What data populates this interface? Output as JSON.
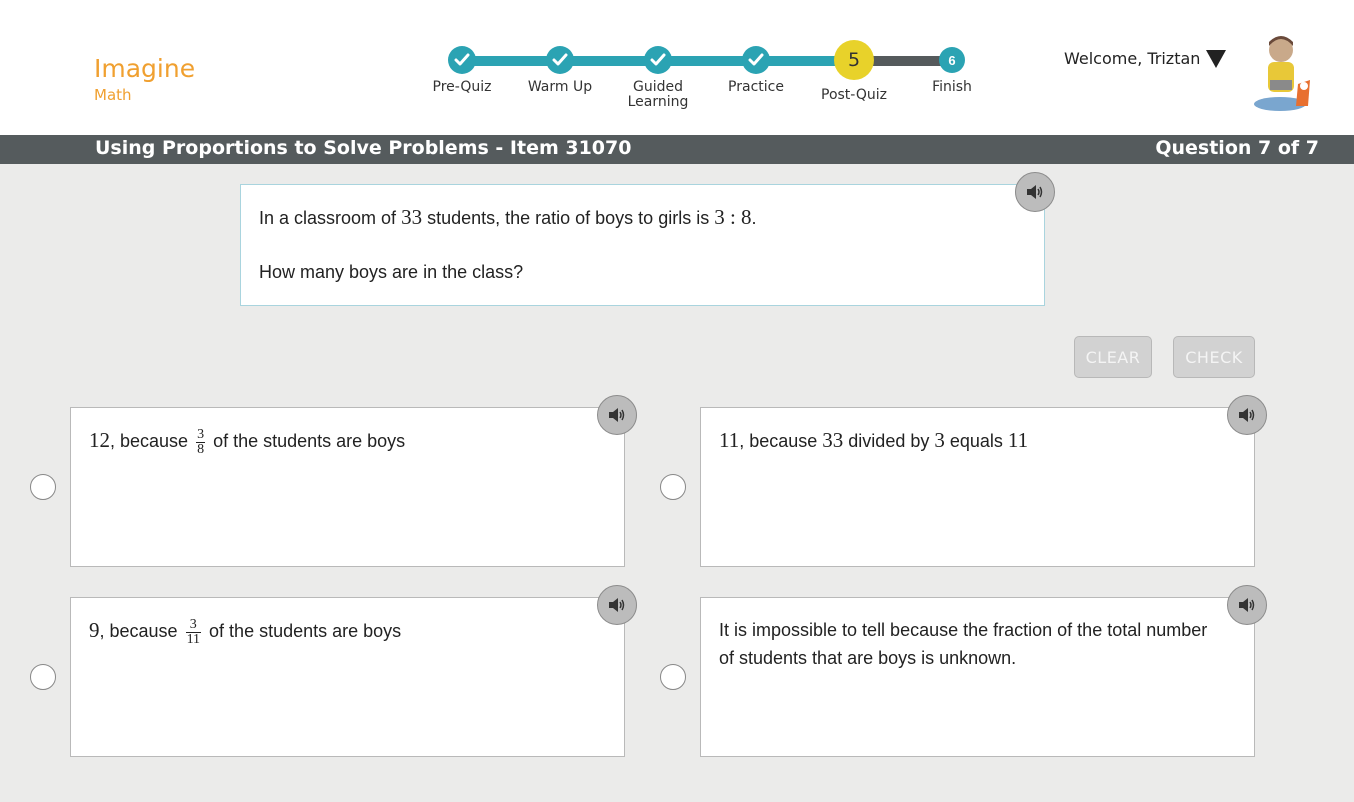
{
  "brand": {
    "name": "Imagine",
    "sub": "Math",
    "color": "#f0a030"
  },
  "progress": {
    "steps": [
      {
        "label": "Pre-Quiz",
        "state": "complete"
      },
      {
        "label": "Warm Up",
        "state": "complete"
      },
      {
        "label": "Guided Learning",
        "state": "complete"
      },
      {
        "label": "Practice",
        "state": "complete"
      },
      {
        "label": "Post-Quiz",
        "state": "current",
        "number": "5"
      },
      {
        "label": "Finish",
        "state": "upcoming",
        "number": "6"
      }
    ],
    "complete_color": "#2ba3b3",
    "current_color": "#e8d22a"
  },
  "user": {
    "welcome": "Welcome, Triztan"
  },
  "header": {
    "lesson_title": "Using Proportions to Solve Problems - Item 31070",
    "question_count": "Question 7 of 7"
  },
  "question": {
    "line1_pre": "In a classroom of ",
    "total": "33",
    "line1_mid": " students, the ratio of boys to girls is ",
    "ratio": "3 : 8",
    "line1_end": ".",
    "line2": "How many boys are in the class?"
  },
  "buttons": {
    "clear": "CLEAR",
    "check": "CHECK"
  },
  "choices": {
    "a": {
      "value": "12",
      "pre": ", because ",
      "num": "3",
      "den": "8",
      "post": " of the students are boys"
    },
    "b": {
      "v1": "11",
      "t1": ", because ",
      "v2": "33",
      "t2": " divided by ",
      "v3": "3",
      "t3": " equals ",
      "v4": "11"
    },
    "c": {
      "value": "9",
      "pre": ", because ",
      "num": "3",
      "den": "11",
      "post": " of the students are boys"
    },
    "d": {
      "text": "It is impossible to tell because the fraction of the total number of students that are boys is unknown."
    }
  }
}
